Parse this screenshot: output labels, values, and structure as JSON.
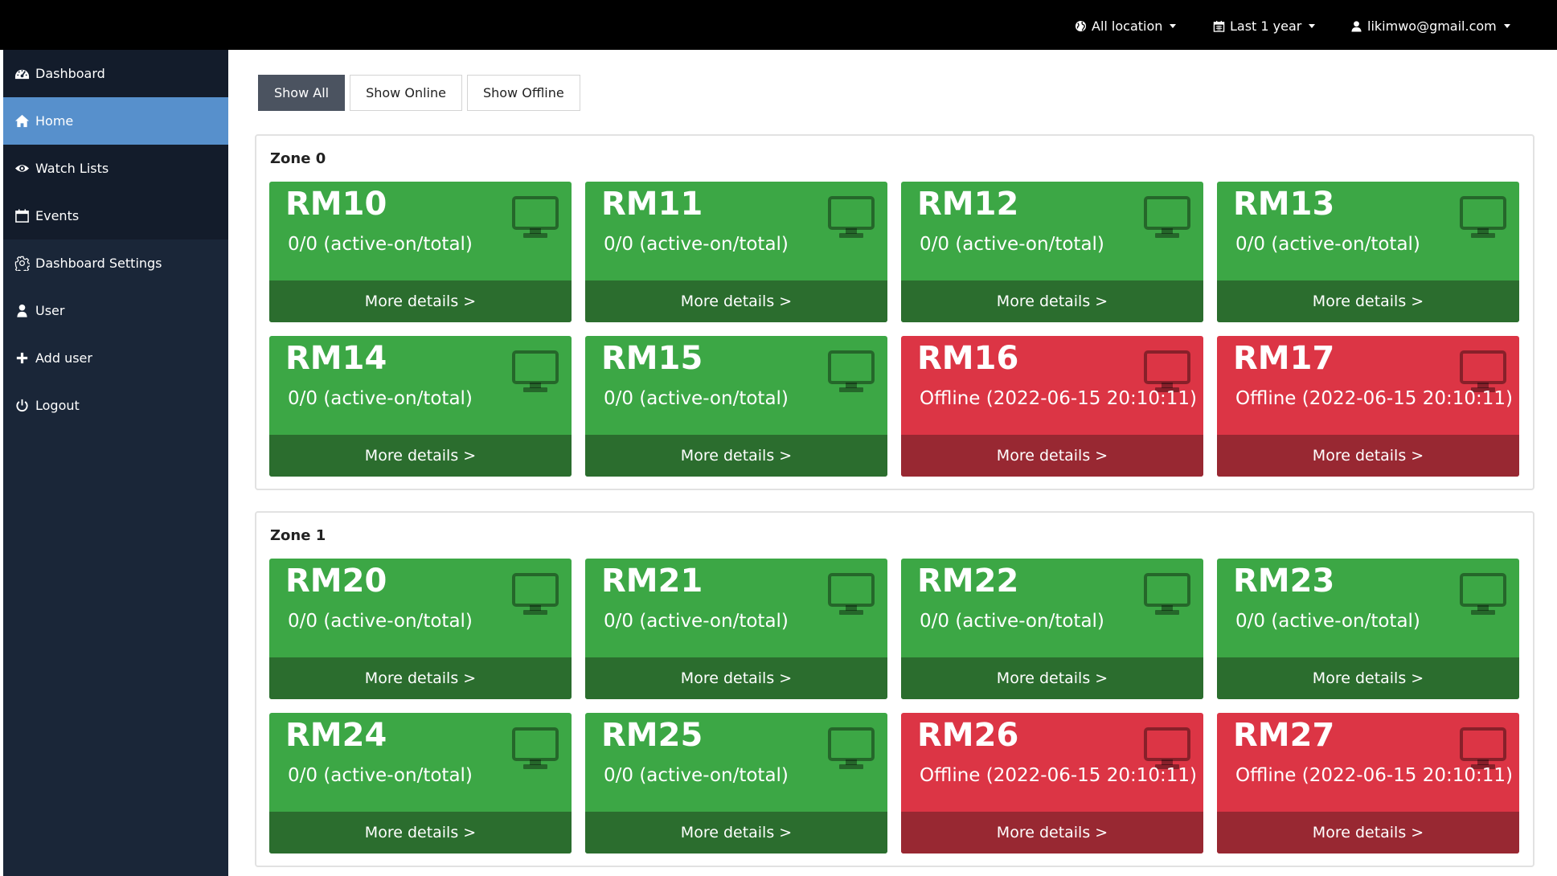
{
  "topbar": {
    "location": "All location",
    "period": "Last 1 year",
    "user": "likimwo@gmail.com"
  },
  "sidebar": {
    "items": [
      {
        "label": "Dashboard",
        "icon": "dashboard-icon"
      },
      {
        "label": "Home",
        "icon": "home-icon"
      },
      {
        "label": "Watch Lists",
        "icon": "eye-icon"
      },
      {
        "label": "Events",
        "icon": "calendar-icon"
      },
      {
        "label": "Dashboard Settings",
        "icon": "gear-icon"
      },
      {
        "label": "User",
        "icon": "user-icon"
      },
      {
        "label": "Add user",
        "icon": "plus-icon"
      },
      {
        "label": "Logout",
        "icon": "power-icon"
      }
    ],
    "active": "Home"
  },
  "filters": {
    "show_all": "Show All",
    "show_online": "Show Online",
    "show_offline": "Show Offline",
    "active": "Show All"
  },
  "colors": {
    "online": "#3ca745",
    "online_footer": "#2b6d2e",
    "offline": "#dc3545",
    "offline_footer": "#982832",
    "sidebar": "#1a2638",
    "sidebar_active": "#5790cc"
  },
  "card_footer": "More details >",
  "zones": [
    {
      "title": "Zone 0",
      "rooms": [
        {
          "name": "RM10",
          "status": "0/0 (active-on/total)",
          "state": "online"
        },
        {
          "name": "RM11",
          "status": "0/0 (active-on/total)",
          "state": "online"
        },
        {
          "name": "RM12",
          "status": "0/0 (active-on/total)",
          "state": "online"
        },
        {
          "name": "RM13",
          "status": "0/0 (active-on/total)",
          "state": "online"
        },
        {
          "name": "RM14",
          "status": "0/0 (active-on/total)",
          "state": "online"
        },
        {
          "name": "RM15",
          "status": "0/0 (active-on/total)",
          "state": "online"
        },
        {
          "name": "RM16",
          "status": "Offline (2022-06-15 20:10:11)",
          "state": "offline"
        },
        {
          "name": "RM17",
          "status": "Offline (2022-06-15 20:10:11)",
          "state": "offline"
        }
      ]
    },
    {
      "title": "Zone 1",
      "rooms": [
        {
          "name": "RM20",
          "status": "0/0 (active-on/total)",
          "state": "online"
        },
        {
          "name": "RM21",
          "status": "0/0 (active-on/total)",
          "state": "online"
        },
        {
          "name": "RM22",
          "status": "0/0 (active-on/total)",
          "state": "online"
        },
        {
          "name": "RM23",
          "status": "0/0 (active-on/total)",
          "state": "online"
        },
        {
          "name": "RM24",
          "status": "0/0 (active-on/total)",
          "state": "online"
        },
        {
          "name": "RM25",
          "status": "0/0 (active-on/total)",
          "state": "online"
        },
        {
          "name": "RM26",
          "status": "Offline (2022-06-15 20:10:11)",
          "state": "offline"
        },
        {
          "name": "RM27",
          "status": "Offline (2022-06-15 20:10:11)",
          "state": "offline"
        }
      ]
    }
  ]
}
